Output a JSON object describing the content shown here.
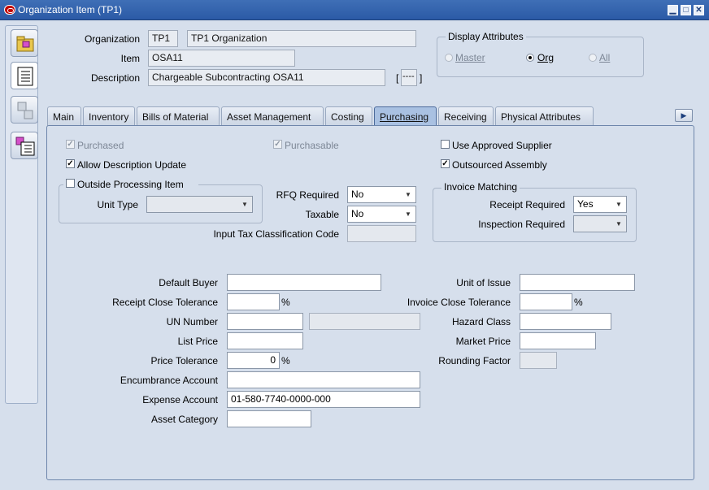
{
  "window": {
    "title": "Organization Item (TP1)",
    "buttons": {
      "minimize": "▁",
      "maximize": "□",
      "close": "✕"
    }
  },
  "header": {
    "organization_label": "Organization",
    "organization_code": "TP1",
    "organization_name": "TP1 Organization",
    "item_label": "Item",
    "item_value": "OSA11",
    "description_label": "Description",
    "description_value": "Chargeable Subcontracting OSA11",
    "flex_bracket_open": "[",
    "flex_value": "----",
    "flex_bracket_close": "]"
  },
  "display_attributes": {
    "title": "Display Attributes",
    "options": [
      {
        "label": "Master",
        "selected": false,
        "enabled": false
      },
      {
        "label": "Org",
        "selected": true,
        "enabled": true
      },
      {
        "label": "All",
        "selected": false,
        "enabled": false
      }
    ]
  },
  "tabs": [
    {
      "label": "Main",
      "active": false
    },
    {
      "label": "Inventory",
      "active": false
    },
    {
      "label": "Bills of Material",
      "active": false
    },
    {
      "label": "Asset Management",
      "active": false
    },
    {
      "label": "Costing",
      "active": false
    },
    {
      "label": "Purchasing",
      "active": true
    },
    {
      "label": "Receiving",
      "active": false
    },
    {
      "label": "Physical Attributes",
      "active": false
    }
  ],
  "tab_scroll_icon": "▶",
  "purchasing": {
    "purchased": {
      "label": "Purchased",
      "checked": true,
      "enabled": false
    },
    "purchasable": {
      "label": "Purchasable",
      "checked": true,
      "enabled": false
    },
    "use_approved_supplier": {
      "label": "Use Approved Supplier",
      "checked": false,
      "enabled": true
    },
    "allow_description_update": {
      "label": "Allow Description Update",
      "checked": true,
      "enabled": true
    },
    "outsourced_assembly": {
      "label": "Outsourced Assembly",
      "checked": true,
      "enabled": true
    },
    "outside_processing": {
      "label": "Outside Processing Item",
      "checked": false,
      "unit_type_label": "Unit Type",
      "unit_type_value": ""
    },
    "rfq_required": {
      "label": "RFQ Required",
      "value": "No"
    },
    "taxable": {
      "label": "Taxable",
      "value": "No"
    },
    "input_tax_label": "Input Tax Classification Code",
    "input_tax_value": "",
    "invoice_matching": {
      "title": "Invoice Matching",
      "receipt_required_label": "Receipt Required",
      "receipt_required_value": "Yes",
      "inspection_required_label": "Inspection Required",
      "inspection_required_value": ""
    },
    "default_buyer_label": "Default Buyer",
    "default_buyer_value": "",
    "unit_of_issue_label": "Unit of Issue",
    "unit_of_issue_value": "",
    "receipt_close_tolerance_label": "Receipt Close Tolerance",
    "receipt_close_tolerance_value": "",
    "invoice_close_tolerance_label": "Invoice Close Tolerance",
    "invoice_close_tolerance_value": "",
    "percent": "%",
    "un_number_label": "UN Number",
    "un_number_value": "",
    "un_number_desc": "",
    "hazard_class_label": "Hazard Class",
    "hazard_class_value": "",
    "list_price_label": "List Price",
    "list_price_value": "",
    "market_price_label": "Market Price",
    "market_price_value": "",
    "price_tolerance_label": "Price Tolerance",
    "price_tolerance_value": "0",
    "rounding_factor_label": "Rounding Factor",
    "rounding_factor_value": "",
    "encumbrance_account_label": "Encumbrance Account",
    "encumbrance_account_value": "",
    "expense_account_label": "Expense Account",
    "expense_account_value": "01-580-7740-0000-000",
    "asset_category_label": "Asset Category",
    "asset_category_value": ""
  },
  "colors": {
    "titlebar": "#2b5aa6",
    "background": "#d6dfec",
    "active_tab": "#a9c1e2"
  }
}
